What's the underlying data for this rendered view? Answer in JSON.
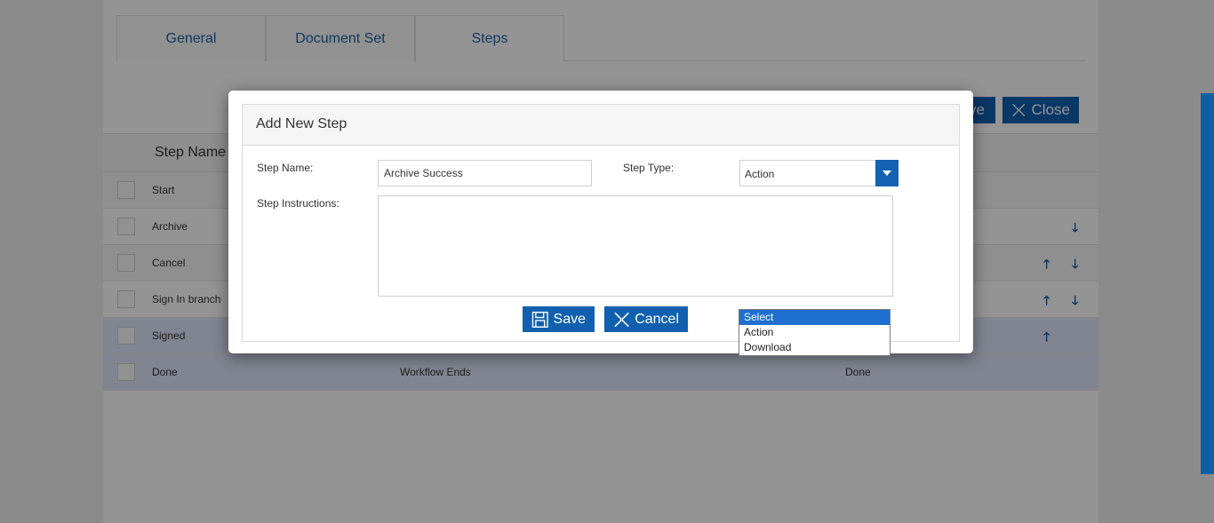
{
  "tabs": [
    "General",
    "Document Set",
    "Steps"
  ],
  "toolbar": {
    "save_label": "ve",
    "close_label": "Close"
  },
  "table": {
    "header": {
      "step_name": "Step Name"
    },
    "rows": [
      {
        "name": "Start",
        "desc": "",
        "type": ""
      },
      {
        "name": "Archive",
        "desc": "",
        "type": ""
      },
      {
        "name": "Cancel",
        "desc": "",
        "type": ""
      },
      {
        "name": "Sign In branch",
        "desc": "",
        "type": ""
      },
      {
        "name": "Signed",
        "desc": "",
        "type": ""
      },
      {
        "name": "Done",
        "desc": "Workflow Ends",
        "type": "Done"
      }
    ]
  },
  "modal": {
    "title": "Add New Step",
    "step_name_label": "Step Name:",
    "step_name_value": "Archive Success",
    "step_type_label": "Step Type:",
    "step_type_value": "Action",
    "instructions_label": "Step Instructions:",
    "instructions_value": "",
    "save_label": "Save",
    "cancel_label": "Cancel"
  },
  "dropdown": {
    "options": [
      "Select",
      "Action",
      "Download"
    ],
    "highlighted": "Select"
  },
  "colors": {
    "accent": "#1060b0",
    "highlight_row": "#dde6fa",
    "dropdown_highlight": "#1e6fd0"
  }
}
